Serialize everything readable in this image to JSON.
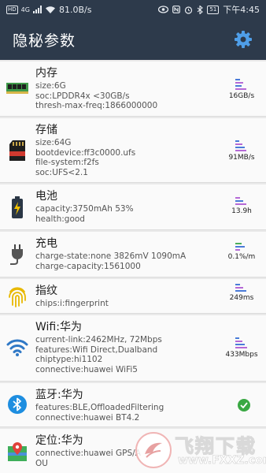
{
  "status_bar": {
    "network_speed": "81.0B/s",
    "time": "下午4:45",
    "hd": "HD",
    "battery": "51",
    "signal": "4G"
  },
  "app_bar": {
    "title": "隐秘参数",
    "settings_icon": "gear-icon"
  },
  "cards": [
    {
      "title": "内存",
      "icon": "ram-icon",
      "lines": [
        "size:6G",
        "soc:LPDDR4x <30GB/s",
        "thresh-max-freq:1866000000"
      ],
      "metric": "16GB/s"
    },
    {
      "title": "存储",
      "icon": "sd-card-icon",
      "lines": [
        "size:64G",
        "bootdevice:ff3c0000.ufs",
        "file-system:f2fs",
        "soc:UFS<2.1"
      ],
      "metric": "91MB/s"
    },
    {
      "title": "电池",
      "icon": "battery-icon",
      "lines": [
        "capacity:3750mAh 53%",
        "health:good"
      ],
      "metric": "13.9h"
    },
    {
      "title": "充电",
      "icon": "charger-plug-icon",
      "lines": [
        "charge-state:none 3826mV 1090mA",
        "charge-capacity:1561000"
      ],
      "metric": "0.1%/m"
    },
    {
      "title": "指纹",
      "icon": "fingerprint-icon",
      "lines": [
        "chips:i:fingerprint"
      ],
      "metric": "249ms"
    },
    {
      "title": "Wifi:华为",
      "icon": "wifi-icon",
      "lines": [
        "current-link:2462MHz, 72Mbps",
        "features:Wifi Direct,Dualband",
        "chiptype:hi1102",
        "connective:huawei WiFi5"
      ],
      "metric": "433Mbps"
    },
    {
      "title": "蓝牙:华为",
      "icon": "bluetooth-icon",
      "lines": [
        "features:BLE,OffloadedFiltering",
        "connective:huawei BT4.2"
      ],
      "metric": ""
    },
    {
      "title": "定位:华为",
      "icon": "map-location-icon",
      "lines": [
        "connective:huawei GPS/A",
        "OU"
      ],
      "metric": ""
    }
  ],
  "watermark": {
    "title": "飞翔下载",
    "url": "www.FXXZ.com"
  },
  "colors": {
    "header": "#2d3a4b",
    "bar_blue": "#4a7bd8",
    "bar_purple": "#b569d6",
    "bar_green": "#4cae5a",
    "ok_green": "#3aa843",
    "gear": "#4f9ee8"
  }
}
